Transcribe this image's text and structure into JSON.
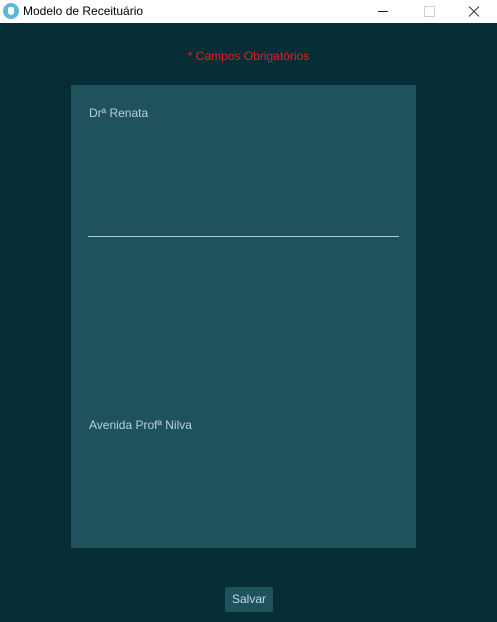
{
  "window": {
    "title": "Modelo de Receituário",
    "app_icon": "tooth-icon",
    "controls": [
      "minimize-icon",
      "maximize-icon",
      "close-icon"
    ]
  },
  "form": {
    "required_note": "* Campos Obrigatórios"
  },
  "prescription": {
    "doctor_name": "Drª Renata",
    "address": "Avenida Profª Nilva"
  },
  "actions": {
    "save_label": "Salvar"
  },
  "colors": {
    "background": "#062c36",
    "card": "#1f525c",
    "required_text": "#e02020",
    "text": "#b9d2d6"
  }
}
